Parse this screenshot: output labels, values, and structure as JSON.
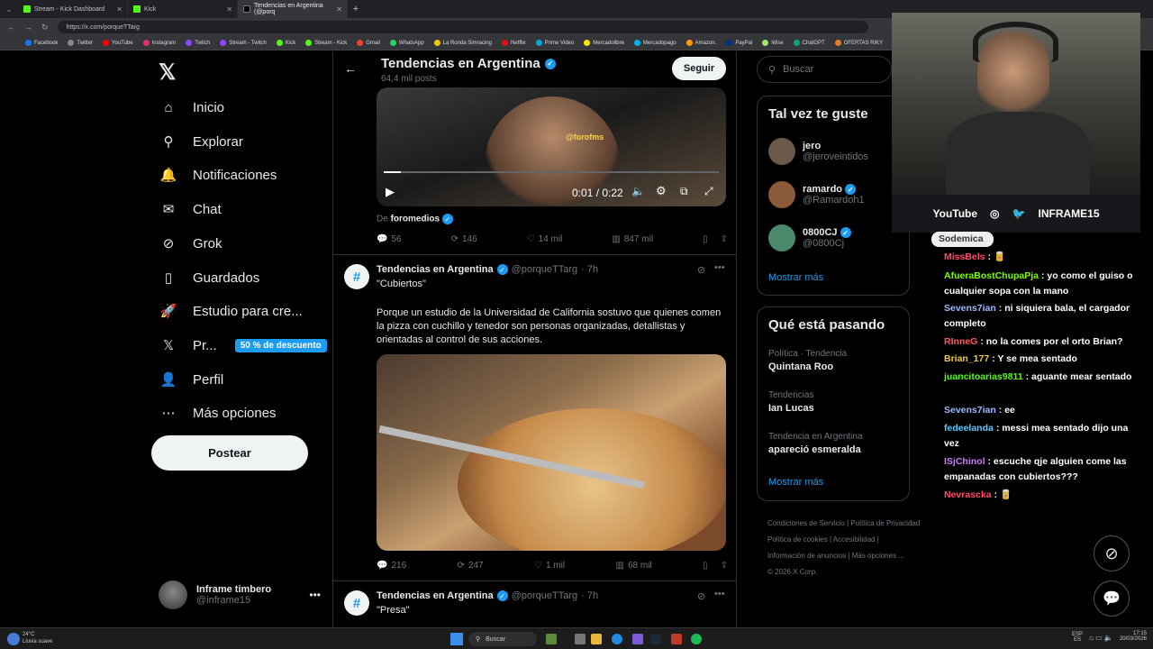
{
  "browser": {
    "tabs": [
      {
        "title": "Stream - Kick Dashboard"
      },
      {
        "title": "Kick"
      },
      {
        "title": "Tendencias en Argentina (@porq"
      }
    ],
    "url": "https://x.com/porqueTTarg",
    "bookmarks": [
      "Facebook",
      "Twitter",
      "YouTube",
      "Instagram",
      "Twitch",
      "Stream - Twitch",
      "Kick",
      "Stream - Kick",
      "Gmail",
      "WhatsApp",
      "La Ronda Simracing",
      "Netflix",
      "Prime Video",
      "Mercadolibre",
      "Mercadopago",
      "Amazon.",
      "PayPal",
      "Wise",
      "ChatGPT",
      "OFERTAS RIKY"
    ]
  },
  "nav": {
    "items": [
      {
        "label": "Inicio",
        "icon": "home-icon"
      },
      {
        "label": "Explorar",
        "icon": "search-icon"
      },
      {
        "label": "Notificaciones",
        "icon": "bell-icon"
      },
      {
        "label": "Chat",
        "icon": "mail-icon"
      },
      {
        "label": "Grok",
        "icon": "grok-icon"
      },
      {
        "label": "Guardados",
        "icon": "bookmark-icon"
      },
      {
        "label": "Estudio para cre...",
        "icon": "rocket-icon"
      },
      {
        "label": "Pr...",
        "icon": "x-premium-icon"
      },
      {
        "label": "Perfil",
        "icon": "person-icon"
      },
      {
        "label": "Más opciones",
        "icon": "more-circle-icon"
      }
    ],
    "premium_badge": "50 % de descuento",
    "post_button": "Postear",
    "account": {
      "name": "Inframe timbero",
      "handle": "@inframe15"
    }
  },
  "header": {
    "title": "Tendencias en Argentina",
    "posts_count": "64,4 mil posts",
    "follow_button": "Seguir"
  },
  "video_post": {
    "watermark": "@forofms",
    "time": "0:01 / 0:22",
    "progress": 0.05,
    "source_prefix": "De",
    "source_name": "foromedios",
    "replies": "56",
    "reposts": "146",
    "likes": "14 mil",
    "views": "847 mil"
  },
  "post2": {
    "name": "Tendencias en Argentina",
    "handle": "@porqueTTarg",
    "time": "· 7h",
    "line1": "\"Cubiertos\"",
    "body": "Porque un estudio de la Universidad de California sostuvo que quienes comen la pizza con cuchillo y tenedor son personas organizadas, detallistas y orientadas al control de sus acciones.",
    "replies": "216",
    "reposts": "247",
    "likes": "1 mil",
    "views": "68 mil"
  },
  "post3": {
    "name": "Tendencias en Argentina",
    "handle": "@porqueTTarg",
    "time": "· 7h",
    "line1": "\"Presa\""
  },
  "right": {
    "search_placeholder": "Buscar",
    "suggest_title": "Tal vez te guste",
    "suggestions": [
      {
        "name": "jero",
        "handle": "@jeroveintidos"
      },
      {
        "name": "ramardo",
        "handle": "@Ramardoh1"
      },
      {
        "name": "0800CJ",
        "handle": "@0800Cj"
      }
    ],
    "show_more": "Mostrar más",
    "trends_title": "Qué está pasando",
    "trends": [
      {
        "category": "Política · Tendencia",
        "name": "Quintana Roo"
      },
      {
        "category": "Tendencias",
        "name": "Ian Lucas"
      },
      {
        "category": "Tendencia en Argentina",
        "name": "apareció esmeralda"
      }
    ],
    "footer": [
      "Condiciones de Servicio",
      "|",
      "Política de Privacidad",
      "Política de cookies",
      "|",
      "Accesibilidad",
      "|",
      "Información de anuncios",
      "|",
      "Más opciones ...",
      "© 2026 X Corp."
    ]
  },
  "stream": {
    "social": [
      "YouTube",
      "INFRAME15"
    ],
    "chat": [
      {
        "user": "Sodemica",
        "text": "",
        "color": "#ffffff"
      },
      {
        "user": "MissBels",
        "text": ": 🥫",
        "color": "#ff4a6a"
      },
      {
        "user": "AfueraBostChupaPja",
        "text": ": yo como el guiso o cualquier sopa con la mano",
        "color": "#7cfc00"
      },
      {
        "user": "Sevens7ian",
        "text": ": ni siquiera bala, el cargador completo",
        "color": "#9ab8ff"
      },
      {
        "user": "RInneG",
        "text": ": no la comes por el orto Brian?",
        "color": "#ff5c5c"
      },
      {
        "user": "Brian_177",
        "text": ": Y se mea sentado",
        "color": "#f7c948"
      },
      {
        "user": "juancitoarias9811",
        "text": ": aguante mear sentado",
        "color": "#53fc18"
      },
      {
        "user": "Sevens7ian",
        "text": ": ee",
        "color": "#9ab8ff"
      },
      {
        "user": "fedeelanda",
        "text": ": messi mea sentado dijo una vez",
        "color": "#5ec8ff"
      },
      {
        "user": "ISjChinol",
        "text": ": escuche qje alguien come las empanadas con cubiertos???",
        "color": "#c77dff"
      },
      {
        "user": "Nevrascka",
        "text": ": 🥫",
        "color": "#ff4a6a"
      }
    ]
  },
  "taskbar": {
    "weather_temp": "24°C",
    "weather_desc": "Lluvia suave",
    "search": "Buscar",
    "lang": "ESP",
    "lang2": "ES",
    "time": "17:15",
    "date": "20/03/2026"
  }
}
